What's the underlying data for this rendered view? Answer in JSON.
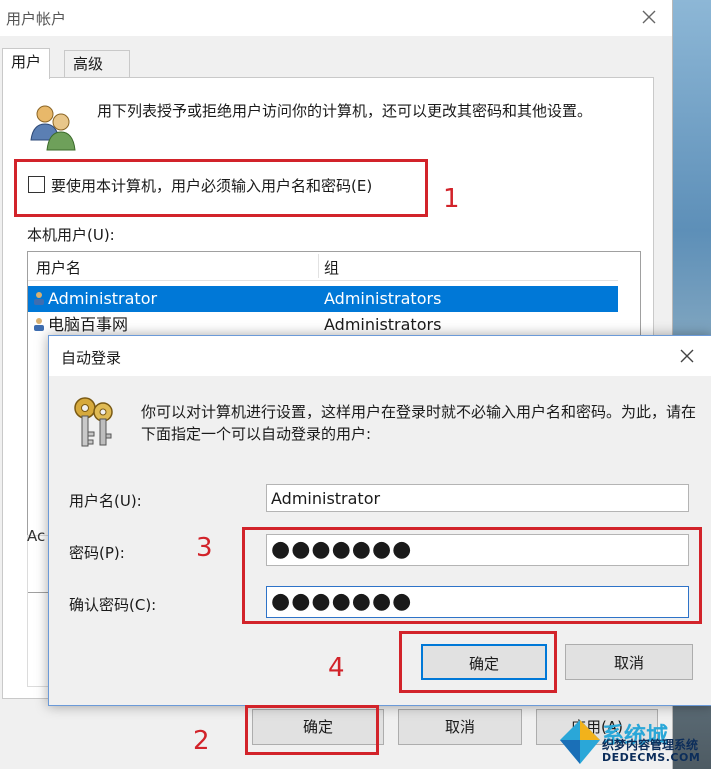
{
  "outer_window": {
    "title": "用户帐户",
    "tabs": [
      {
        "label": "用户"
      },
      {
        "label": "高级"
      }
    ],
    "intro_text": "用下列表授予或拒绝用户访问你的计算机，还可以更改其密码和其他设置。",
    "require_password_label": "要使用本计算机，用户必须输入用户名和密码(E)",
    "local_users_label": "本机用户(U):",
    "columns": [
      "用户名",
      "组"
    ],
    "users": [
      {
        "name": "Administrator",
        "group": "Administrators",
        "selected": true
      },
      {
        "name": "电脑百事网",
        "group": "Administrators",
        "selected": false
      }
    ],
    "partial_group_label": "Ac",
    "buttons": {
      "ok": "确定",
      "cancel": "取消",
      "apply": "应用(A)"
    }
  },
  "auto_login_dialog": {
    "title": "自动登录",
    "intro_text": "你可以对计算机进行设置，这样用户在登录时就不必输入用户名和密码。为此，请在下面指定一个可以自动登录的用户:",
    "username_label": "用户名(U):",
    "username_value": "Administrator",
    "password_label": "密码(P):",
    "password_value": "●●●●●●●",
    "confirm_label": "确认密码(C):",
    "confirm_value": "●●●●●●●",
    "ok_label": "确定",
    "cancel_label": "取消"
  },
  "annotations": {
    "n1": "1",
    "n2": "2",
    "n3": "3",
    "n4": "4"
  },
  "watermark": {
    "brand": "系统城",
    "line1": "织梦内容管理系统",
    "line2": "DEDECMS.COM"
  },
  "colors": {
    "selection": "#0078d7",
    "annotation": "#d2232a",
    "focus_border": "#2e73c8"
  }
}
